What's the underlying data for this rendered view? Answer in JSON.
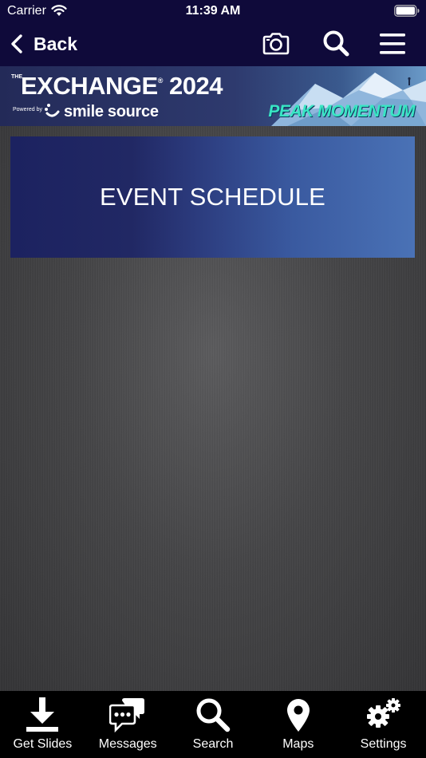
{
  "status_bar": {
    "carrier": "Carrier",
    "time": "11:39 AM"
  },
  "nav": {
    "back_label": "Back"
  },
  "banner": {
    "the": "THE",
    "title": "EXCHANGE",
    "registered_mark": "®",
    "year": "2024",
    "powered_by": "Powered by",
    "brand": "smile source",
    "tagline": "PEAK MOMENTUM"
  },
  "content": {
    "tile_label": "EVENT SCHEDULE"
  },
  "tabs": [
    {
      "label": "Get Slides",
      "icon": "download-icon"
    },
    {
      "label": "Messages",
      "icon": "chat-bubbles-icon"
    },
    {
      "label": "Search",
      "icon": "search-icon"
    },
    {
      "label": "Maps",
      "icon": "map-pin-icon"
    },
    {
      "label": "Settings",
      "icon": "gears-icon"
    }
  ],
  "colors": {
    "nav_background": "#0f0a3a",
    "tab_background": "#000000",
    "tagline": "#39e6c4",
    "tile_gradient_start": "#1c2260",
    "tile_gradient_end": "#4a72b6"
  }
}
